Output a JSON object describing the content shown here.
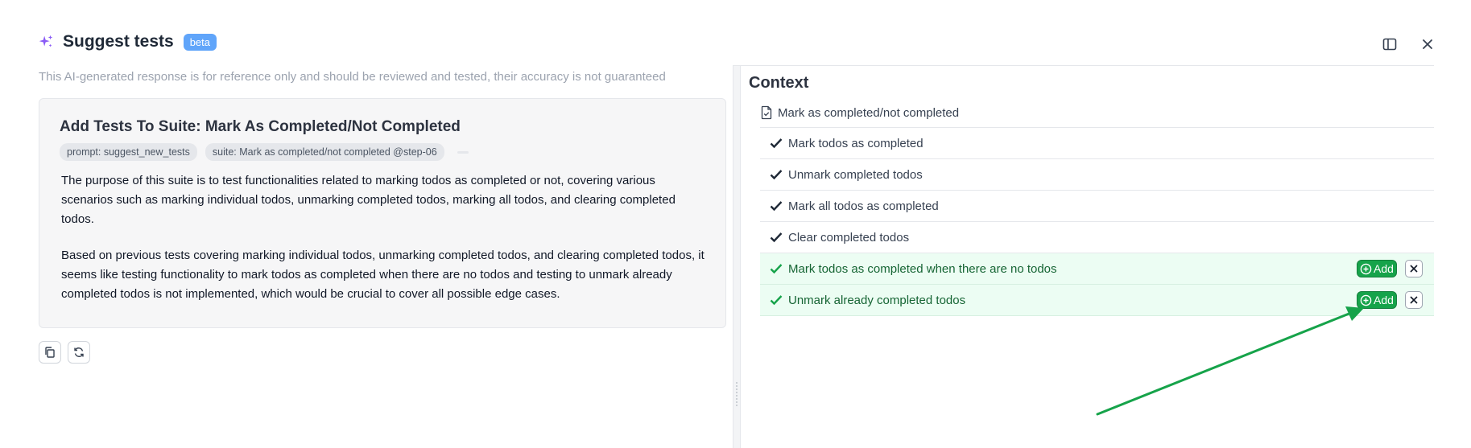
{
  "header": {
    "title": "Suggest tests",
    "badge": "beta"
  },
  "left": {
    "disclaimer": "This AI-generated response is for reference only and should be reviewed and tested, their accuracy is not guaranteed",
    "card": {
      "title": "Add Tests To Suite: Mark As Completed/Not Completed",
      "tags": [
        "prompt: suggest_new_tests",
        "suite: Mark as completed/not completed @step-06"
      ],
      "paragraphs": [
        "The purpose of this suite is to test functionalities related to marking todos as completed or not, covering various scenarios such as marking individual todos, unmarking completed todos, marking all todos, and clearing completed todos.",
        "Based on previous tests covering marking individual todos, unmarking completed todos, and clearing completed todos, it seems like testing functionality to mark todos as completed when there are no todos and testing to unmark already completed todos is not implemented, which would be crucial to cover all possible edge cases."
      ]
    }
  },
  "context": {
    "title": "Context",
    "suite": "Mark as completed/not completed",
    "tests": [
      "Mark todos as completed",
      "Unmark completed todos",
      "Mark all todos as completed",
      "Clear completed todos"
    ],
    "suggested": [
      "Mark todos as completed when there are no todos",
      "Unmark already completed todos"
    ],
    "add_label": "Add"
  },
  "colors": {
    "accent_green": "#16a34a",
    "suggested_bg": "#ecfdf3",
    "beta_blue": "#60a5fa",
    "sparkle_purple": "#8b5cf6"
  },
  "icons": [
    "sparkle-icon",
    "panel-toggle-icon",
    "close-icon",
    "copy-icon",
    "refresh-icon",
    "file-check-icon",
    "check-icon",
    "plus-circle-icon",
    "x-icon"
  ]
}
